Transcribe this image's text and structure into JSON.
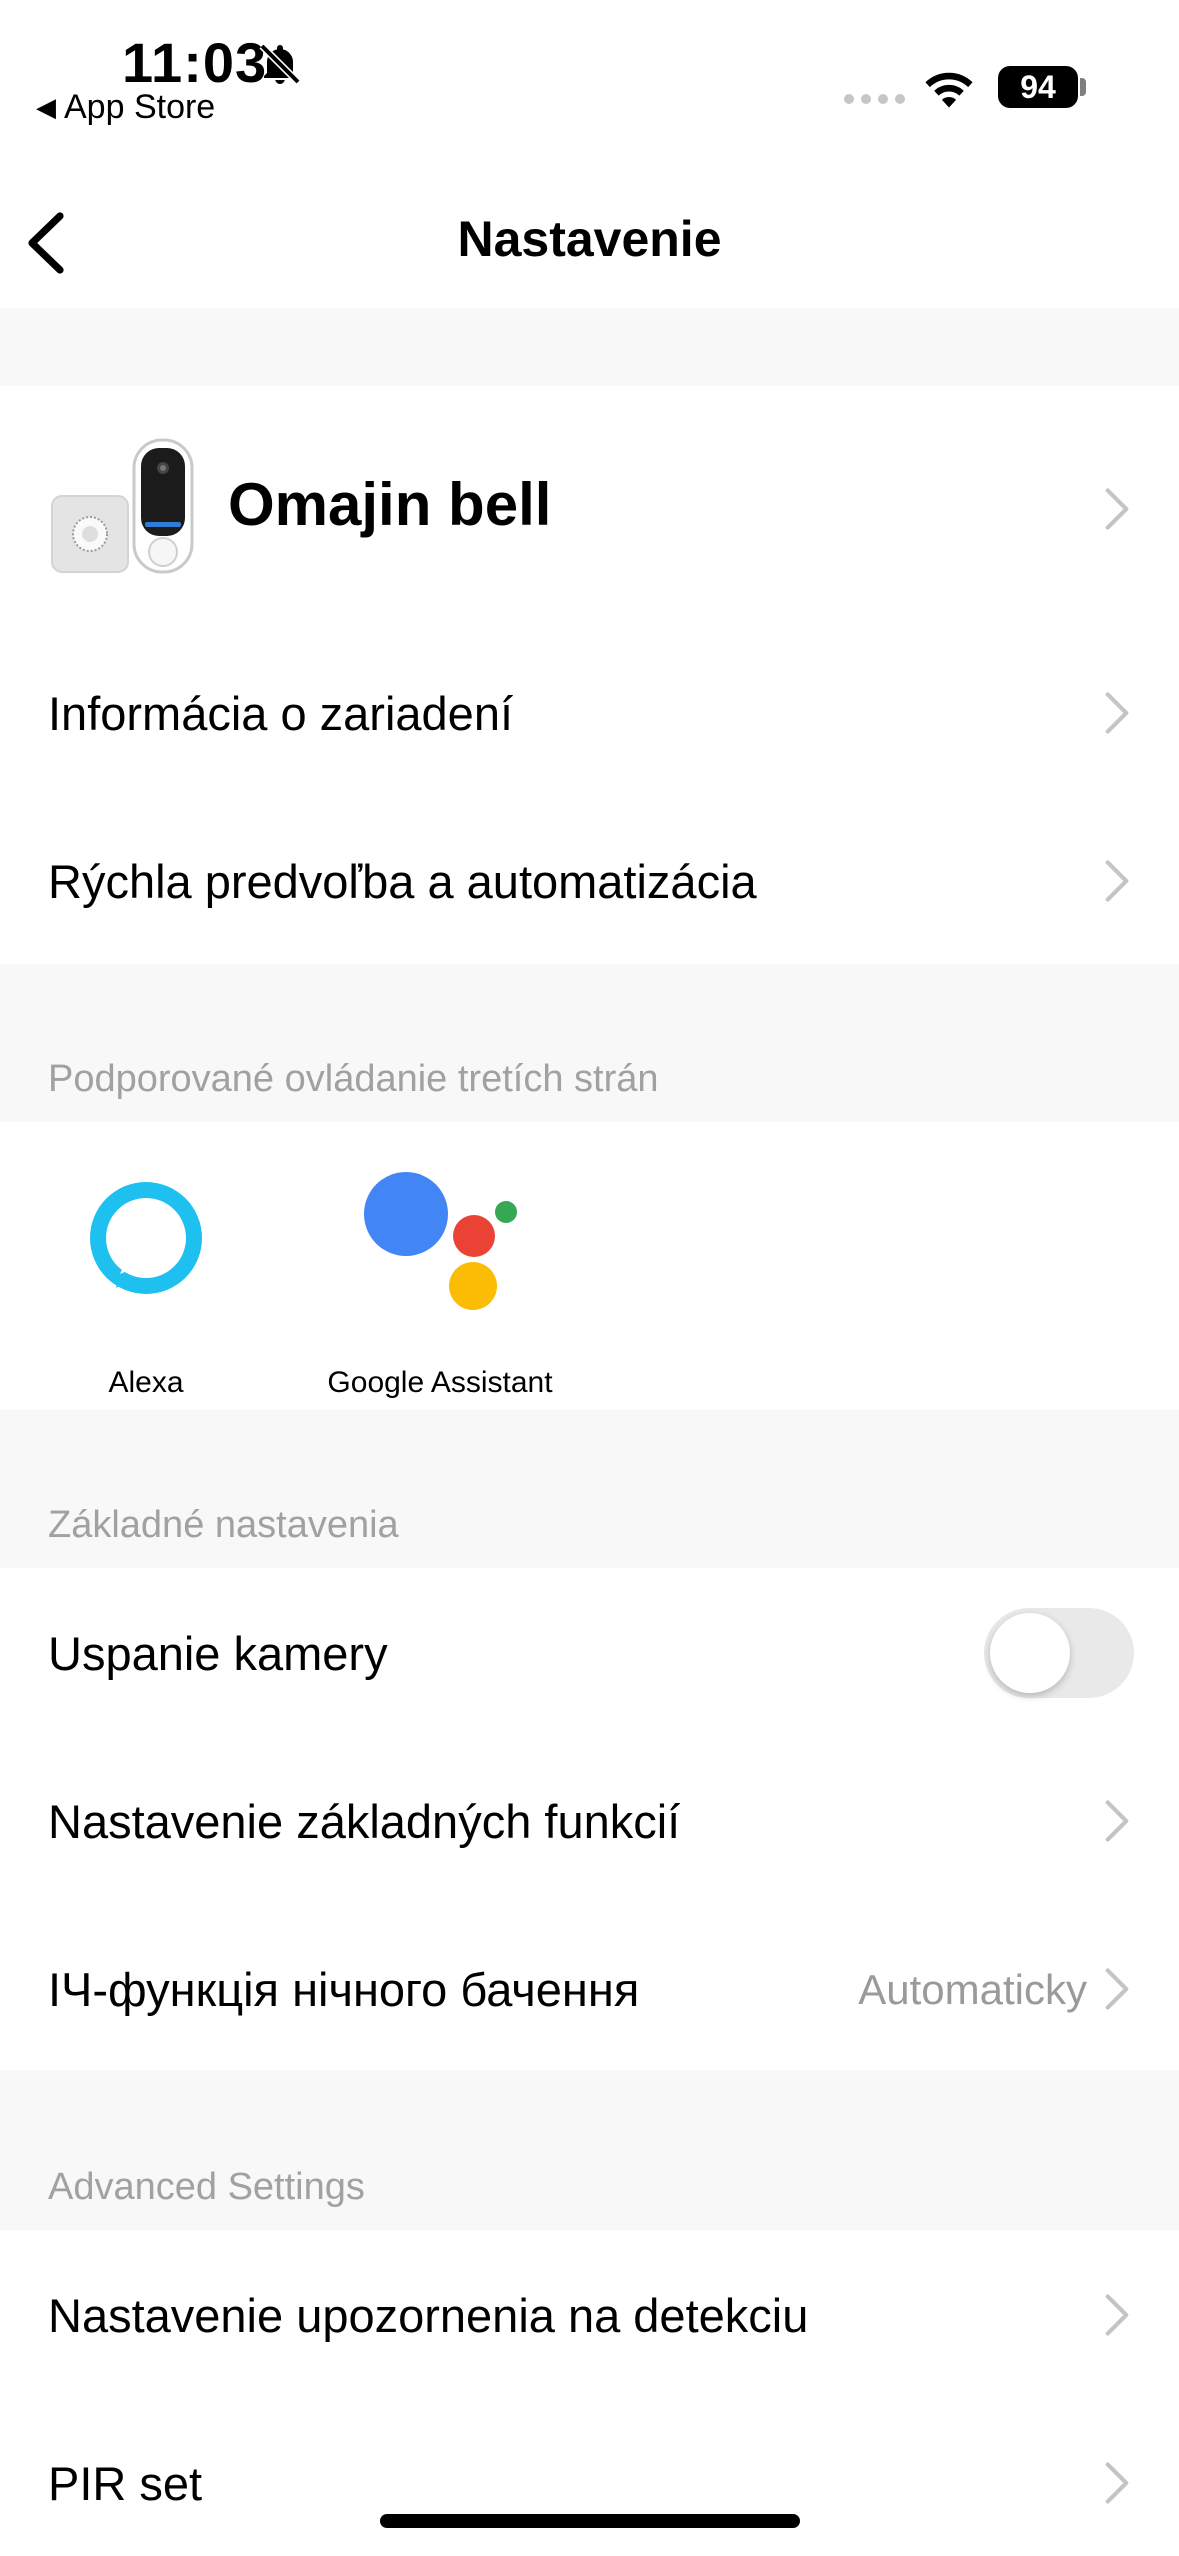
{
  "status_bar": {
    "time": "11:03",
    "back_app": "App Store",
    "battery": "94",
    "icons": [
      "bell-slash-icon",
      "signal-dots-icon",
      "wifi-icon",
      "battery-icon"
    ]
  },
  "nav": {
    "title": "Nastavenie",
    "back_icon": "chevron-left-icon"
  },
  "device": {
    "name": "Omajin bell",
    "image": "doorbell-device-image"
  },
  "device_rows": [
    {
      "label": "Informácia o zariadení"
    },
    {
      "label": "Rýchla predvoľba a automatizácia"
    }
  ],
  "third_party": {
    "header": "Podporované ovládanie tretích strán",
    "items": [
      {
        "label": "Alexa",
        "icon": "alexa-icon"
      },
      {
        "label": "Google Assistant",
        "icon": "google-assistant-icon"
      }
    ]
  },
  "basic": {
    "header": "Základné nastavenia",
    "camera_sleep": {
      "label": "Uspanie kamery",
      "on": false
    },
    "basic_functions": {
      "label": "Nastavenie základných funkcií"
    },
    "ir_night": {
      "label": "ІЧ-функція нічного бачення",
      "value": "Automaticky"
    }
  },
  "advanced": {
    "header": "Advanced Settings",
    "items": [
      {
        "label": "Nastavenie upozornenia na detekciu"
      },
      {
        "label": "PIR set"
      }
    ]
  },
  "colors": {
    "alexa": "#1ec0f0",
    "google_blue": "#4285f4",
    "google_red": "#ea4335",
    "google_yellow": "#fbbc05",
    "google_green": "#34a853",
    "section_bg": "#f8f8f8",
    "secondary_text": "#a1a1a1"
  }
}
